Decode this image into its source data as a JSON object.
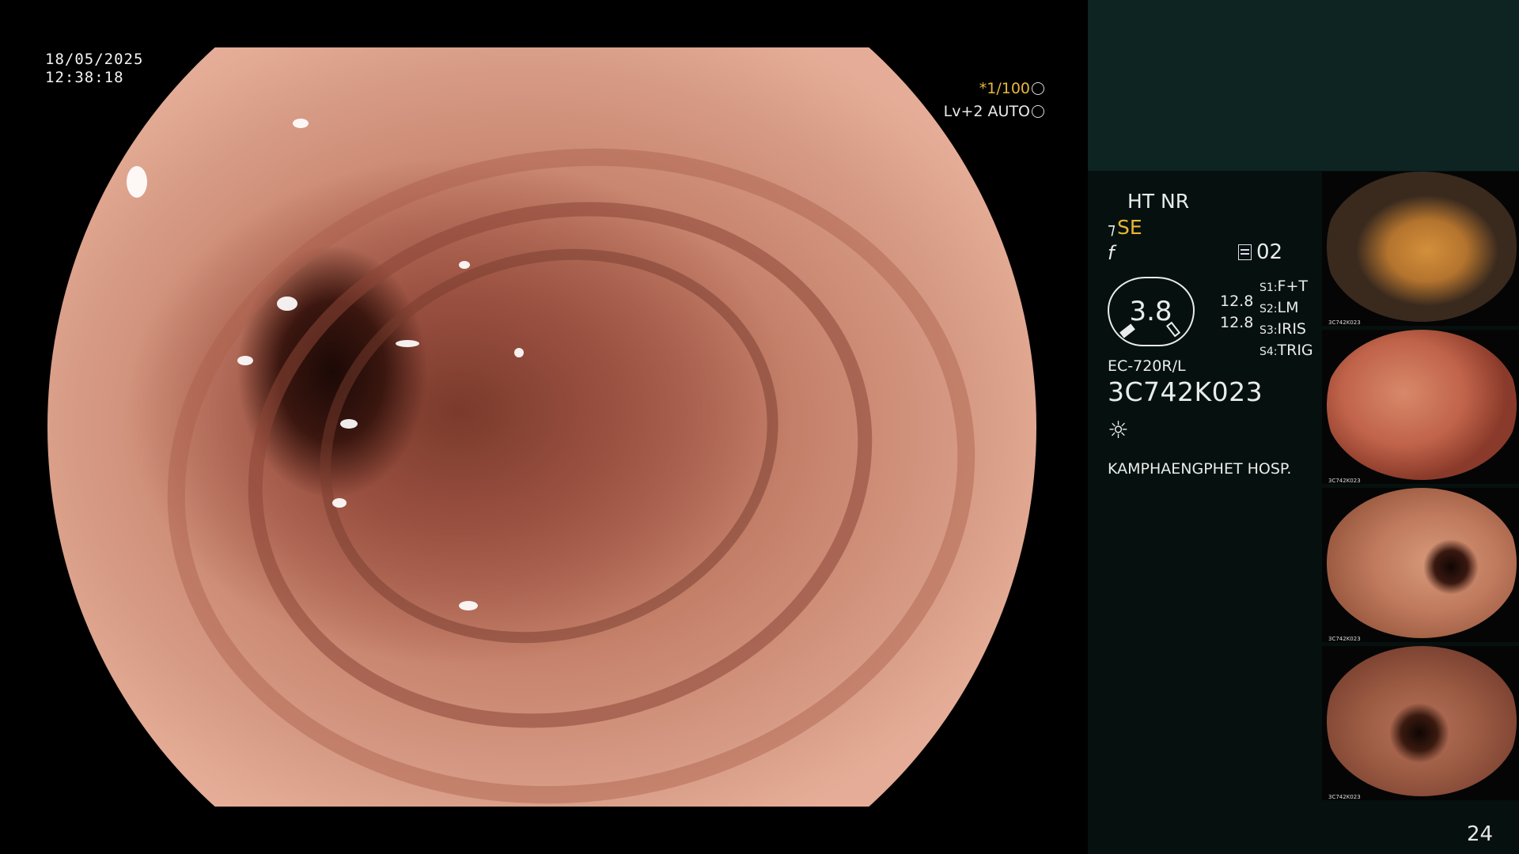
{
  "overlay": {
    "date": "18/05/2025",
    "time": "12:38:18",
    "shutter": "*1/100",
    "level": "Lv+2 AUTO"
  },
  "panel": {
    "enhance": "HT NR",
    "mode": "SE",
    "fn_symbol": "f",
    "memory": "02",
    "gauge_value": "3.8",
    "gauge_side": [
      "12.8",
      "12.8"
    ],
    "switches": [
      {
        "key": "S1:",
        "value": "F+T"
      },
      {
        "key": "S2:",
        "value": "LM"
      },
      {
        "key": "S3:",
        "value": "IRIS"
      },
      {
        "key": "S4:",
        "value": "TRIG"
      }
    ],
    "scope_model": "EC-720R/L",
    "scope_serial": "3C742K023",
    "light_icon": "light-source-icon",
    "hospital": "KAMPHAENGPHET HOSP."
  },
  "thumbnails": [
    {
      "id": "thumb-1",
      "caption": "3C742K023"
    },
    {
      "id": "thumb-2",
      "caption": "3C742K023"
    },
    {
      "id": "thumb-3",
      "caption": "3C742K023"
    },
    {
      "id": "thumb-4",
      "caption": "3C742K023"
    }
  ],
  "page_number": "24",
  "colors": {
    "accent_yellow": "#e9b633",
    "panel_top": "#0d2422",
    "panel_bg": "#06100e"
  }
}
